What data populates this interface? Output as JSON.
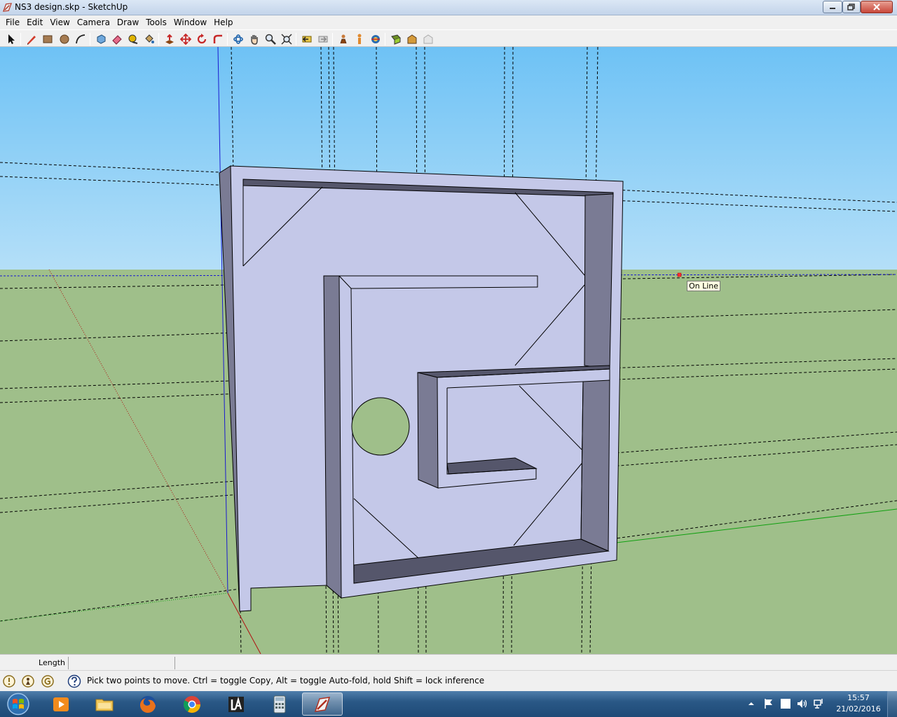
{
  "window": {
    "title": "NS3 design.skp - SketchUp"
  },
  "menu": {
    "items": [
      "File",
      "Edit",
      "View",
      "Camera",
      "Draw",
      "Tools",
      "Window",
      "Help"
    ]
  },
  "toolbar": {
    "tools": [
      "select",
      "line",
      "rectangle",
      "circle",
      "arc",
      "make-component",
      "eraser",
      "tape-measure",
      "paint-bucket",
      "push-pull",
      "move",
      "rotate",
      "follow-me",
      "orbit",
      "pan",
      "zoom",
      "zoom-extents",
      "previous-view",
      "next-view",
      "walk",
      "look-around",
      "position-camera",
      "section-plane",
      "get-models",
      "share-model",
      "extension-warehouse"
    ]
  },
  "viewport": {
    "tooltip": "On Line",
    "sky_color": "#87ceeb",
    "ground_color": "#9fbf8a",
    "face_color": "#c4c8e8",
    "shadow_color": "#7a7b94"
  },
  "measure": {
    "label": "Length",
    "value": ""
  },
  "status": {
    "text": "Pick two points to move.  Ctrl = toggle Copy, Alt = toggle Auto-fold, hold Shift = lock inference"
  },
  "taskbar": {
    "apps": [
      "media-player",
      "file-explorer",
      "firefox",
      "chrome",
      "layout",
      "calculator",
      "sketchup"
    ],
    "time": "15:57",
    "date": "21/02/2016"
  }
}
